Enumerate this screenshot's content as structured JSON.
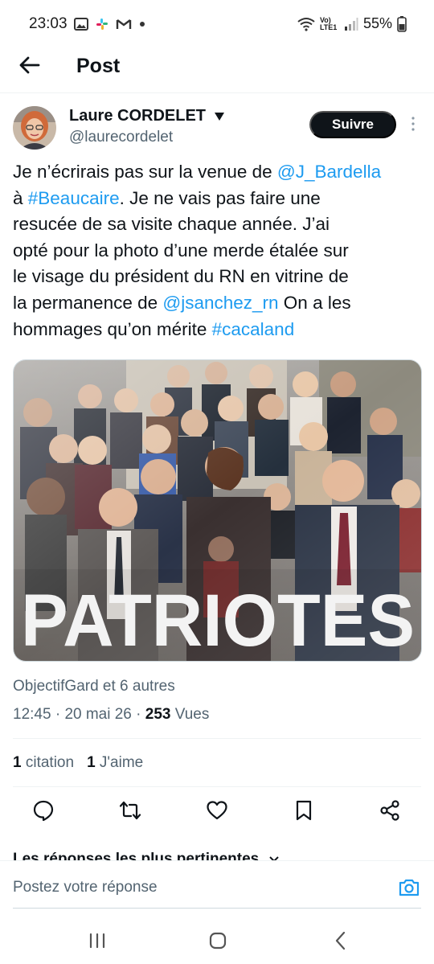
{
  "status_bar": {
    "time": "23:03",
    "network_label": "Vo) LTE1",
    "battery": "55%"
  },
  "header": {
    "title": "Post"
  },
  "author": {
    "name": "Laure CORDELET",
    "handle": "@laurecordelet",
    "follow_label": "Suivre"
  },
  "tweet": {
    "segments": [
      {
        "text": "Je n’écrirais pas sur la venue de ",
        "link": false
      },
      {
        "text": "@J_Bardella",
        "link": true
      },
      {
        "text": "à ",
        "link": false
      },
      {
        "text": "#Beaucaire",
        "link": true
      },
      {
        "text": ". Je ne vais pas faire une",
        "link": false
      },
      {
        "text": "resucée de sa visite chaque année. J’ai",
        "link": false
      },
      {
        "text": "opté pour la photo d’une merde étalée sur",
        "link": false
      },
      {
        "text": "le visage du président du RN en vitrine de",
        "link": false
      },
      {
        "text": "la permanence de ",
        "link": false
      },
      {
        "text": "@jsanchez_rn",
        "link": true
      },
      {
        "text": " On a les",
        "link": false
      },
      {
        "text": "hommages qu’on mérite ",
        "link": false
      },
      {
        "text": "#cacaland",
        "link": true
      }
    ],
    "image_caption_text": "PATRIOTES"
  },
  "meta": {
    "replied_by": "ObjectifGard et 6 autres",
    "time": "12:45",
    "date": "20 mai 26",
    "views_count": "253",
    "views_label": "Vues",
    "separator": "·"
  },
  "stats": {
    "quotes_count": "1",
    "quotes_label": "citation",
    "likes_count": "1",
    "likes_label": "J'aime"
  },
  "actions": [
    "reply-icon",
    "retweet-icon",
    "like-icon",
    "bookmark-icon",
    "share-icon"
  ],
  "top_replies_label": "Les réponses les plus pertinentes",
  "reply": {
    "placeholder": "Postez votre réponse"
  },
  "colors": {
    "link": "#1d9bf0",
    "text": "#0f1419",
    "secondary": "#536471",
    "follow_bg": "#0f1419"
  }
}
